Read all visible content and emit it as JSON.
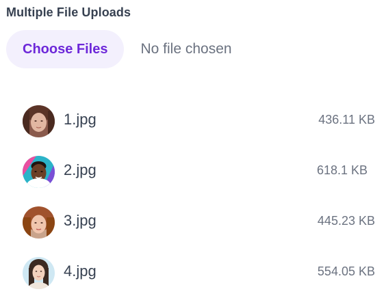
{
  "uploader": {
    "title": "Multiple File Uploads",
    "choose_button_label": "Choose Files",
    "status_text": "No file chosen"
  },
  "files": [
    {
      "name": "1.jpg",
      "size": "436.11 KB"
    },
    {
      "name": "2.jpg",
      "size": "618.1 KB"
    },
    {
      "name": "3.jpg",
      "size": "445.23 KB"
    },
    {
      "name": "4.jpg",
      "size": "554.05 KB"
    }
  ],
  "colors": {
    "accent": "#6d28d9",
    "button_bg": "#f3f0fd",
    "text": "#374151",
    "muted": "#6b7280"
  }
}
